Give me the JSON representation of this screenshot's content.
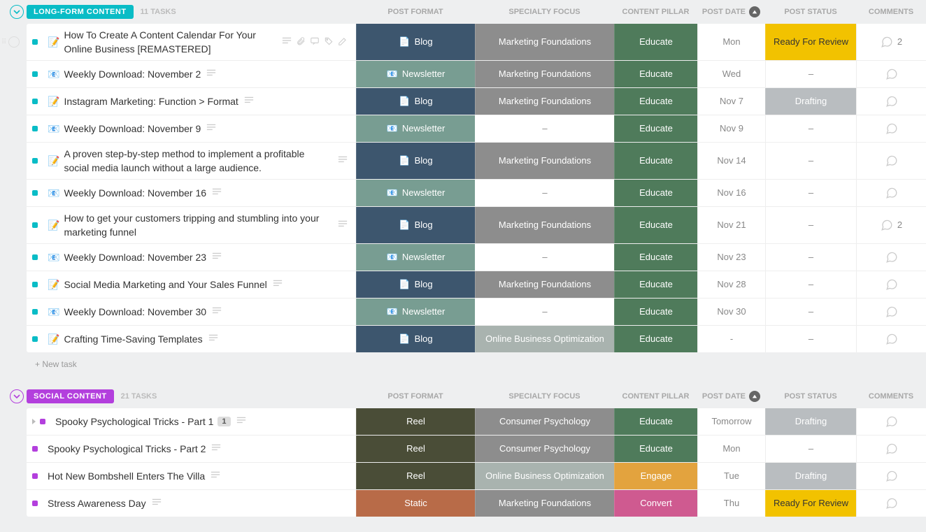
{
  "columns": {
    "format": "POST FORMAT",
    "focus": "SPECIALTY FOCUS",
    "pillar": "CONTENT PILLAR",
    "date": "POST DATE",
    "status": "POST STATUS",
    "comments": "COMMENTS"
  },
  "colors": {
    "blog_bg": "#3d566e",
    "newsletter_bg": "#789d92",
    "reel_bg": "#4a4d37",
    "static_bg": "#b86b48",
    "focus_gray": "#8d8d8d",
    "focus_alt": "#a9b3af",
    "pillar_educate": "#4f7b5b",
    "pillar_engage": "#e3a33e",
    "pillar_convert": "#cf5a90",
    "date_bg": "#ffffff",
    "status_ready": "#f2c200",
    "status_drafting": "#b9bdc0",
    "group_long": "#09bcc6",
    "group_social": "#b33fdd"
  },
  "groups": [
    {
      "id": "long-form",
      "label": "LONG-FORM CONTENT",
      "task_count": "11 TASKS",
      "accent": "#09bcc6",
      "dot": "#09bcc6",
      "new_task_label": "+ New task",
      "rows": [
        {
          "title": "How To Create A Content Calendar For Your Online Business [REMASTERED]",
          "doc_emoji": "📝",
          "tall": true,
          "show_handle": true,
          "toolbar": true,
          "format": {
            "label": "Blog",
            "bg": "#3d566e",
            "icon": "doc"
          },
          "focus": {
            "label": "Marketing Foundations",
            "bg": "#8d8d8d"
          },
          "pillar": {
            "label": "Educate",
            "bg": "#4f7b5b"
          },
          "date": "Mon",
          "status": {
            "label": "Ready For Review",
            "bg": "#f2c200",
            "fg": "#333"
          },
          "comments": 2
        },
        {
          "title": "Weekly Download: November 2",
          "doc_emoji": "📧",
          "format": {
            "label": "Newsletter",
            "bg": "#789d92",
            "icon": "mail"
          },
          "focus": {
            "label": "Marketing Foundations",
            "bg": "#8d8d8d"
          },
          "pillar": {
            "label": "Educate",
            "bg": "#4f7b5b"
          },
          "date": "Wed",
          "status": {
            "label": "–",
            "bg": "",
            "fg": "#888"
          }
        },
        {
          "title": "Instagram Marketing: Function > Format",
          "doc_emoji": "📝",
          "format": {
            "label": "Blog",
            "bg": "#3d566e",
            "icon": "doc"
          },
          "focus": {
            "label": "Marketing Foundations",
            "bg": "#8d8d8d"
          },
          "pillar": {
            "label": "Educate",
            "bg": "#4f7b5b"
          },
          "date": "Nov 7",
          "status": {
            "label": "Drafting",
            "bg": "#b9bdc0",
            "fg": "#fff"
          }
        },
        {
          "title": "Weekly Download: November 9",
          "doc_emoji": "📧",
          "format": {
            "label": "Newsletter",
            "bg": "#789d92",
            "icon": "mail"
          },
          "focus": {
            "label": "–",
            "bg": "",
            "fg": "#888"
          },
          "pillar": {
            "label": "Educate",
            "bg": "#4f7b5b"
          },
          "date": "Nov 9",
          "status": {
            "label": "–",
            "bg": "",
            "fg": "#888"
          }
        },
        {
          "title": "A proven step-by-step method to implement a profitable social media launch without a large audience.",
          "doc_emoji": "📝",
          "tall": true,
          "format": {
            "label": "Blog",
            "bg": "#3d566e",
            "icon": "doc"
          },
          "focus": {
            "label": "Marketing Foundations",
            "bg": "#8d8d8d"
          },
          "pillar": {
            "label": "Educate",
            "bg": "#4f7b5b"
          },
          "date": "Nov 14",
          "status": {
            "label": "–",
            "bg": "",
            "fg": "#888"
          }
        },
        {
          "title": "Weekly Download: November 16",
          "doc_emoji": "📧",
          "format": {
            "label": "Newsletter",
            "bg": "#789d92",
            "icon": "mail"
          },
          "focus": {
            "label": "–",
            "bg": "",
            "fg": "#888"
          },
          "pillar": {
            "label": "Educate",
            "bg": "#4f7b5b"
          },
          "date": "Nov 16",
          "status": {
            "label": "–",
            "bg": "",
            "fg": "#888"
          }
        },
        {
          "title": "How to get your customers tripping and stumbling into your marketing funnel",
          "doc_emoji": "📝",
          "tall": true,
          "format": {
            "label": "Blog",
            "bg": "#3d566e",
            "icon": "doc"
          },
          "focus": {
            "label": "Marketing Foundations",
            "bg": "#8d8d8d"
          },
          "pillar": {
            "label": "Educate",
            "bg": "#4f7b5b"
          },
          "date": "Nov 21",
          "status": {
            "label": "–",
            "bg": "",
            "fg": "#888"
          },
          "comments": 2
        },
        {
          "title": "Weekly Download: November 23",
          "doc_emoji": "📧",
          "format": {
            "label": "Newsletter",
            "bg": "#789d92",
            "icon": "mail"
          },
          "focus": {
            "label": "–",
            "bg": "",
            "fg": "#888"
          },
          "pillar": {
            "label": "Educate",
            "bg": "#4f7b5b"
          },
          "date": "Nov 23",
          "status": {
            "label": "–",
            "bg": "",
            "fg": "#888"
          }
        },
        {
          "title": "Social Media Marketing and Your Sales Funnel",
          "doc_emoji": "📝",
          "format": {
            "label": "Blog",
            "bg": "#3d566e",
            "icon": "doc"
          },
          "focus": {
            "label": "Marketing Foundations",
            "bg": "#8d8d8d"
          },
          "pillar": {
            "label": "Educate",
            "bg": "#4f7b5b"
          },
          "date": "Nov 28",
          "status": {
            "label": "–",
            "bg": "",
            "fg": "#888"
          }
        },
        {
          "title": "Weekly Download: November 30",
          "doc_emoji": "📧",
          "format": {
            "label": "Newsletter",
            "bg": "#789d92",
            "icon": "mail"
          },
          "focus": {
            "label": "–",
            "bg": "",
            "fg": "#888"
          },
          "pillar": {
            "label": "Educate",
            "bg": "#4f7b5b"
          },
          "date": "Nov 30",
          "status": {
            "label": "–",
            "bg": "",
            "fg": "#888"
          }
        },
        {
          "title": "Crafting Time-Saving Templates",
          "doc_emoji": "📝",
          "format": {
            "label": "Blog",
            "bg": "#3d566e",
            "icon": "doc"
          },
          "focus": {
            "label": "Online Business Optimization",
            "bg": "#a9b3af"
          },
          "pillar": {
            "label": "Educate",
            "bg": "#4f7b5b"
          },
          "date": "-",
          "status": {
            "label": "–",
            "bg": "",
            "fg": "#888"
          }
        }
      ]
    },
    {
      "id": "social",
      "label": "SOCIAL CONTENT",
      "task_count": "21 TASKS",
      "accent": "#b33fdd",
      "dot": "#b33fdd",
      "rows": [
        {
          "title": "Spooky Psychological Tricks - Part 1",
          "has_subtasks": true,
          "sub_badge": "1",
          "format": {
            "label": "Reel",
            "bg": "#4a4d37"
          },
          "focus": {
            "label": "Consumer Psychology",
            "bg": "#8d8d8d"
          },
          "pillar": {
            "label": "Educate",
            "bg": "#4f7b5b"
          },
          "date": "Tomorrow",
          "status": {
            "label": "Drafting",
            "bg": "#b9bdc0",
            "fg": "#fff"
          }
        },
        {
          "title": "Spooky Psychological Tricks - Part 2",
          "format": {
            "label": "Reel",
            "bg": "#4a4d37"
          },
          "focus": {
            "label": "Consumer Psychology",
            "bg": "#8d8d8d"
          },
          "pillar": {
            "label": "Educate",
            "bg": "#4f7b5b"
          },
          "date": "Mon",
          "status": {
            "label": "–",
            "bg": "",
            "fg": "#888"
          }
        },
        {
          "title": "Hot New Bombshell Enters The Villa",
          "format": {
            "label": "Reel",
            "bg": "#4a4d37"
          },
          "focus": {
            "label": "Online Business Optimization",
            "bg": "#a9b3af"
          },
          "pillar": {
            "label": "Engage",
            "bg": "#e3a33e"
          },
          "date": "Tue",
          "status": {
            "label": "Drafting",
            "bg": "#b9bdc0",
            "fg": "#fff"
          }
        },
        {
          "title": "Stress Awareness Day",
          "format": {
            "label": "Static",
            "bg": "#b86b48"
          },
          "focus": {
            "label": "Marketing Foundations",
            "bg": "#8d8d8d"
          },
          "pillar": {
            "label": "Convert",
            "bg": "#cf5a90"
          },
          "date": "Thu",
          "status": {
            "label": "Ready For Review",
            "bg": "#f2c200",
            "fg": "#333"
          }
        }
      ]
    }
  ]
}
